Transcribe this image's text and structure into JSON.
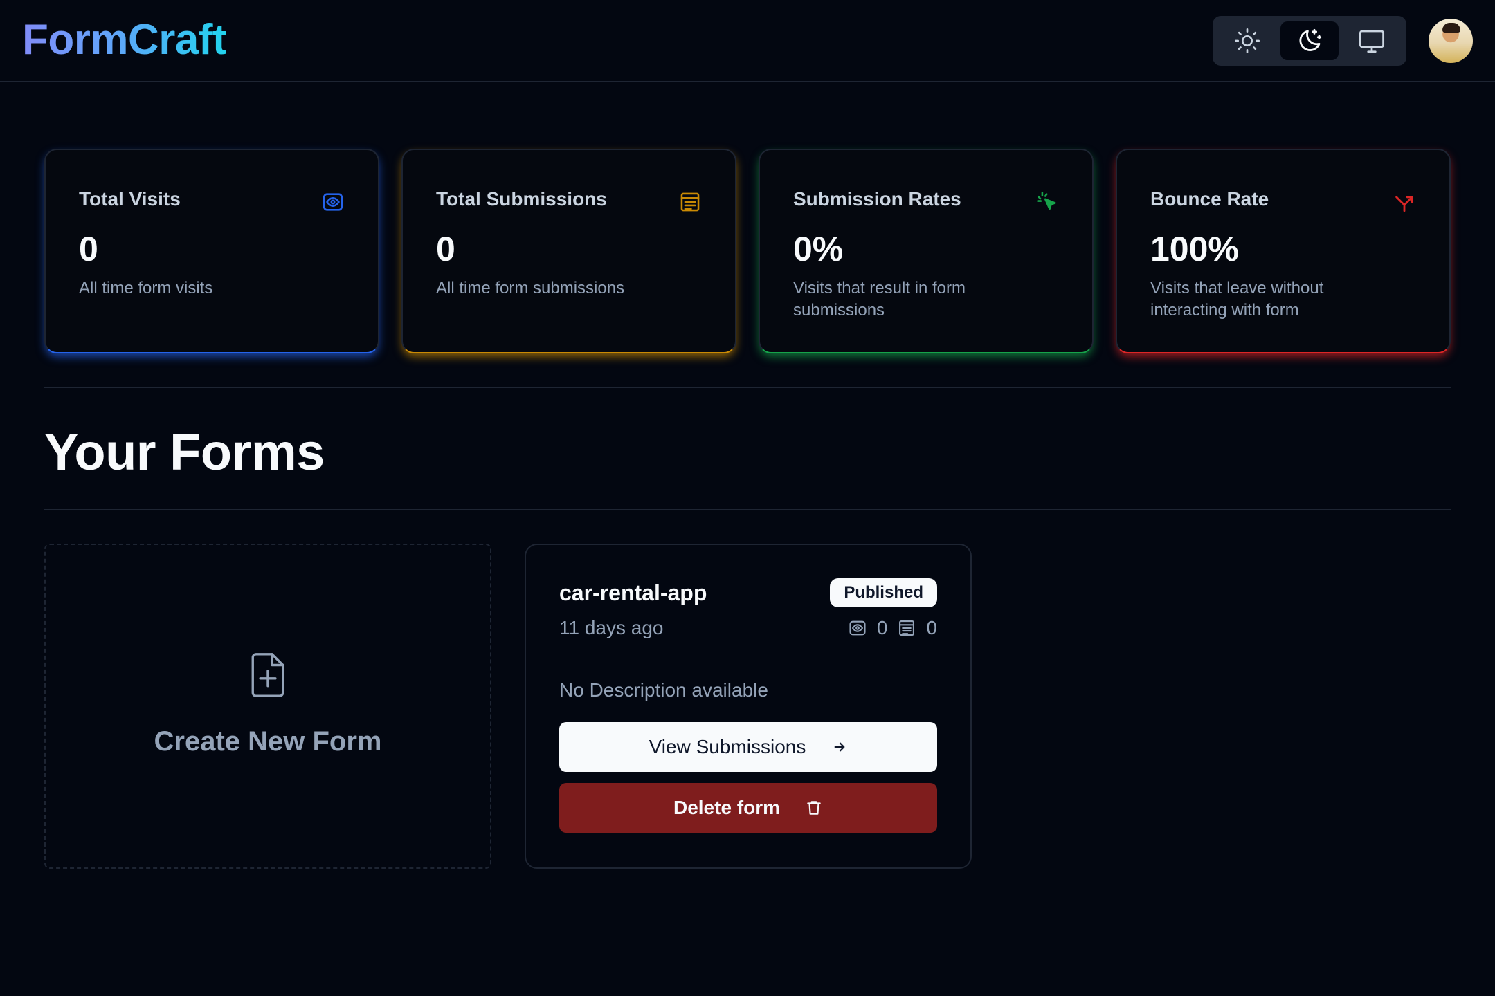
{
  "app": {
    "name": "FormCraft"
  },
  "header": {
    "theme_options": [
      "light",
      "dark",
      "system"
    ],
    "active_theme": "dark"
  },
  "stats": [
    {
      "title": "Total Visits",
      "value": "0",
      "helper": "All time form visits",
      "icon": "eye-icon",
      "color": "#2563eb"
    },
    {
      "title": "Total Submissions",
      "value": "0",
      "helper": "All time form submissions",
      "icon": "form-icon",
      "color": "#ca8a04"
    },
    {
      "title": "Submission Rates",
      "value": "0%",
      "helper": "Visits that result in form submissions",
      "icon": "cursor-click-icon",
      "color": "#16a34a"
    },
    {
      "title": "Bounce Rate",
      "value": "100%",
      "helper": "Visits that leave without interacting with form",
      "icon": "split-arrow-icon",
      "color": "#dc2626"
    }
  ],
  "forms_section": {
    "title": "Your Forms",
    "create_label": "Create New Form",
    "forms": [
      {
        "name": "car-rental-app",
        "status": "Published",
        "created": "11 days ago",
        "visits": "0",
        "submissions": "0",
        "description": "No Description available",
        "view_label": "View Submissions",
        "delete_label": "Delete form"
      }
    ]
  }
}
